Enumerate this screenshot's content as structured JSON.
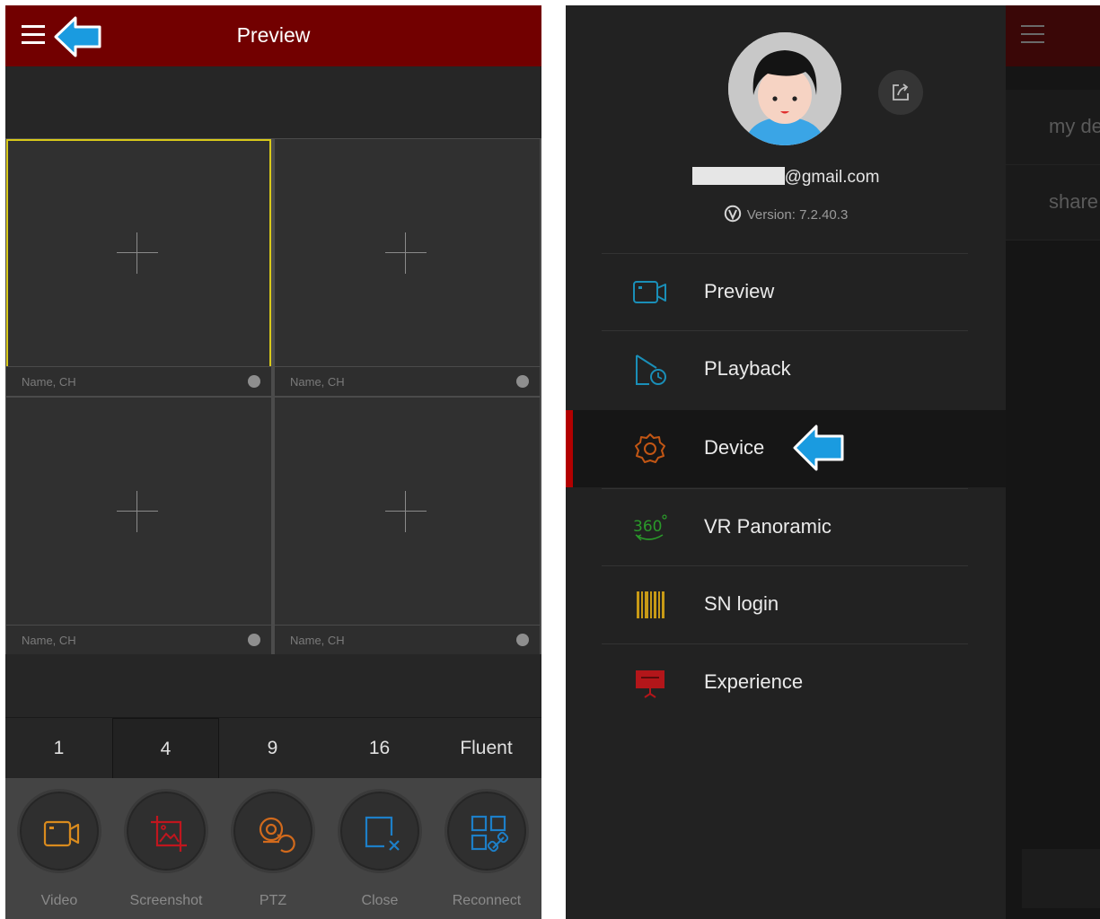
{
  "left": {
    "header": {
      "title": "Preview"
    },
    "cells": [
      {
        "name": "Name, CH"
      },
      {
        "name": "Name, CH"
      },
      {
        "name": "Name, CH"
      },
      {
        "name": "Name, CH"
      }
    ],
    "split_options": [
      "1",
      "4",
      "9",
      "16",
      "Fluent"
    ],
    "selected_split": "4",
    "tools": [
      {
        "label": "Video",
        "icon": "video-icon",
        "color": "#d98b1e"
      },
      {
        "label": "Screenshot",
        "icon": "screenshot-icon",
        "color": "#c0161e"
      },
      {
        "label": "PTZ",
        "icon": "ptz-icon",
        "color": "#d26a1c"
      },
      {
        "label": "Close",
        "icon": "close-window-icon",
        "color": "#1d7fc8"
      },
      {
        "label": "Reconnect",
        "icon": "reconnect-icon",
        "color": "#1d7fc8"
      }
    ]
  },
  "drawer": {
    "email_suffix": "@gmail.com",
    "version": "Version: 7.2.40.3",
    "items": [
      {
        "label": "Preview",
        "icon": "camera-icon",
        "color": "#1a8fb8"
      },
      {
        "label": "PLayback",
        "icon": "playback-icon",
        "color": "#1a8fb8"
      },
      {
        "label": "Device",
        "icon": "gear-icon",
        "color": "#c25614",
        "active": true
      },
      {
        "label": "VR Panoramic",
        "icon": "vr-360-icon",
        "color": "#2a9a2a"
      },
      {
        "label": "SN login",
        "icon": "barcode-icon",
        "color": "#c89a16"
      },
      {
        "label": "Experience",
        "icon": "presentation-icon",
        "color": "#b3161a"
      }
    ],
    "active_color": "#b30000"
  },
  "background_screen": {
    "rows": [
      "my de",
      "share"
    ]
  },
  "colors": {
    "header_red": "#720000",
    "annotation_arrow": "#1a9be0",
    "selection_yellow": "#d8c91a"
  }
}
